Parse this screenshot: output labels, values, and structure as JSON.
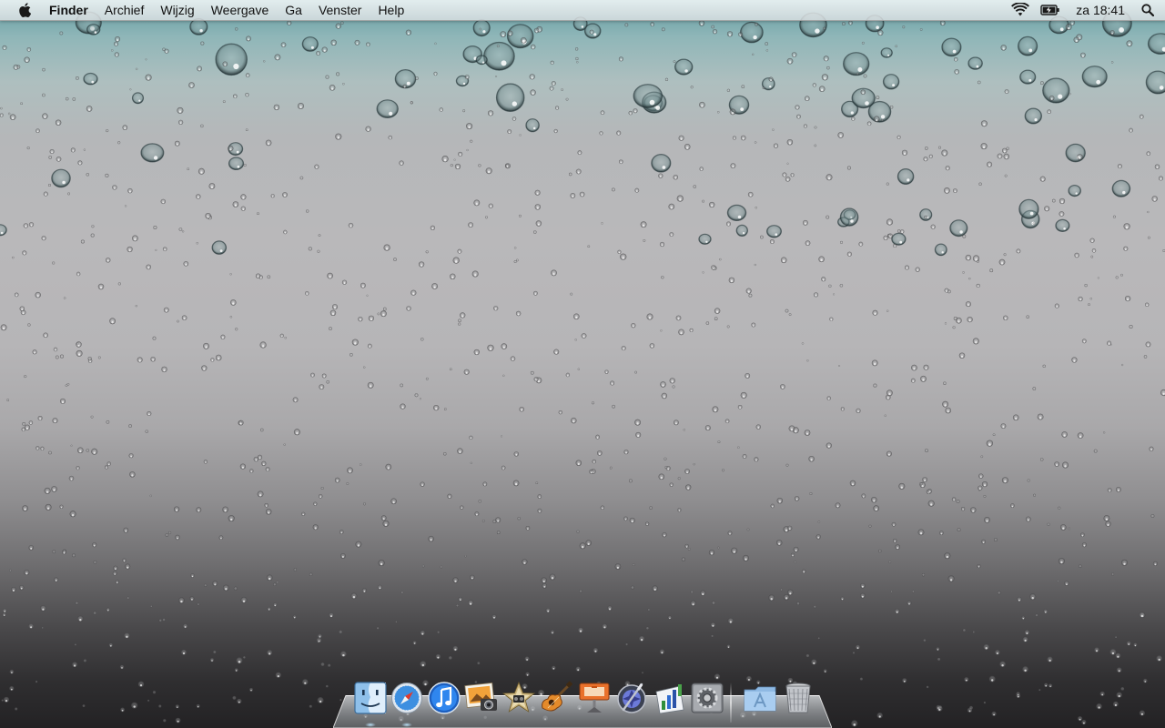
{
  "menubar": {
    "apple_icon": "apple-logo-icon",
    "app_name": "Finder",
    "menus": [
      "Archief",
      "Wijzig",
      "Weergave",
      "Ga",
      "Venster",
      "Help"
    ],
    "status": {
      "wifi_icon": "wifi-icon",
      "battery_icon": "battery-charging-icon",
      "clock": "za 18:41",
      "spotlight_icon": "spotlight-search-icon"
    }
  },
  "desktop": {
    "wallpaper": "raindrops on glass, teal-grey gradient"
  },
  "dock": {
    "apps": [
      {
        "name": "Finder",
        "icon": "finder-icon",
        "running": true
      },
      {
        "name": "Safari",
        "icon": "safari-icon",
        "running": true
      },
      {
        "name": "iTunes",
        "icon": "itunes-icon",
        "running": false
      },
      {
        "name": "iPhoto",
        "icon": "iphoto-icon",
        "running": false
      },
      {
        "name": "iMovie",
        "icon": "imovie-icon",
        "running": false
      },
      {
        "name": "GarageBand",
        "icon": "garageband-icon",
        "running": false
      },
      {
        "name": "Keynote",
        "icon": "keynote-icon",
        "running": false
      },
      {
        "name": "Aperture",
        "icon": "aperture-icon",
        "running": false
      },
      {
        "name": "Numbers",
        "icon": "numbers-icon",
        "running": false
      },
      {
        "name": "System Preferences",
        "icon": "system-preferences-icon",
        "running": false
      }
    ],
    "stacks": [
      {
        "name": "Applications",
        "icon": "applications-folder-icon"
      },
      {
        "name": "Trash",
        "icon": "trash-icon"
      }
    ]
  },
  "colors": {
    "menubar_bg": "#e6e8ea",
    "wallpaper_top": "#5f9aa0",
    "wallpaper_mid": "#b8b7b9",
    "wallpaper_bottom": "#232224"
  }
}
